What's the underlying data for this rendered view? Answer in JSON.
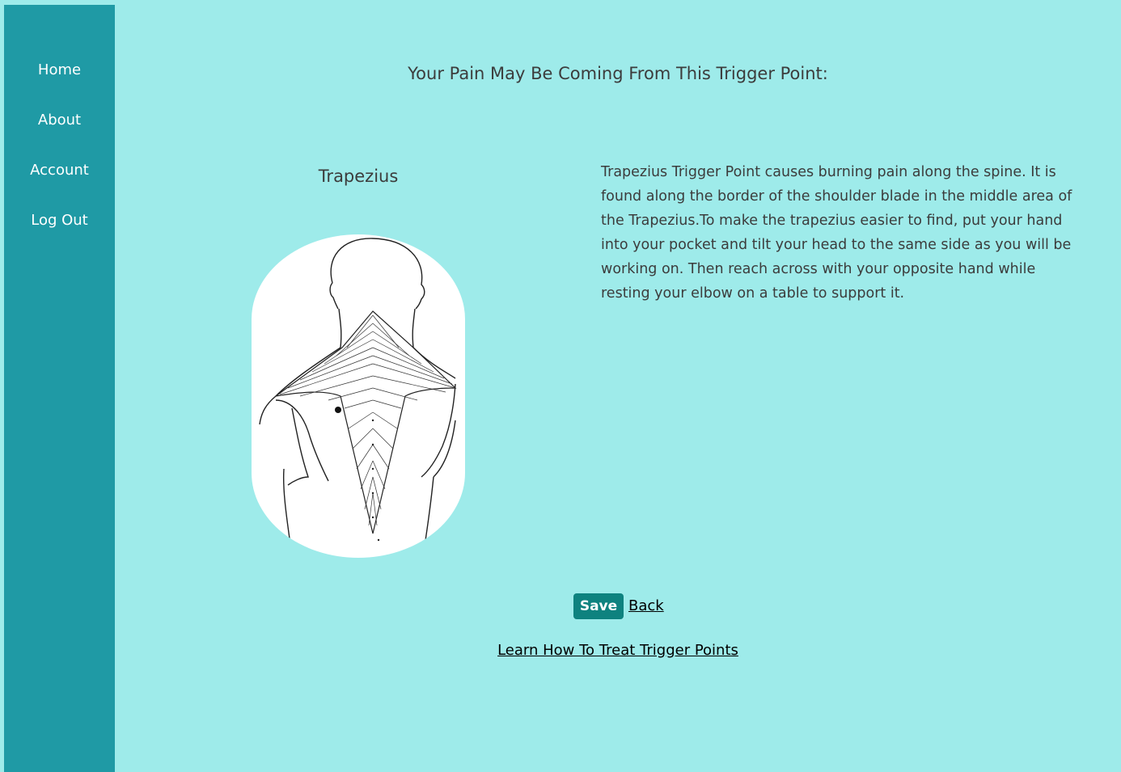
{
  "nav": {
    "items": [
      {
        "label": "Home"
      },
      {
        "label": "About"
      },
      {
        "label": "Account"
      },
      {
        "label": "Log Out"
      }
    ]
  },
  "main": {
    "heading": "Your Pain May Be Coming From This Trigger Point:",
    "muscle_name": "Trapezius",
    "description": "Trapezius Trigger Point causes burning pain along the spine. It is found along the border of the shoulder blade in the middle area of the Trapezius.To make the trapezius easier to find, put your hand into your pocket and tilt your head to the same side as you will be working on. Then reach across with your opposite hand while resting your elbow on a table to support it."
  },
  "actions": {
    "save_label": "Save",
    "back_label": "Back",
    "learn_label": "Learn How To Treat Trigger Points"
  },
  "colors": {
    "background": "#9eebea",
    "sidebar": "#1f9aa5",
    "save_button": "#0e827f"
  }
}
